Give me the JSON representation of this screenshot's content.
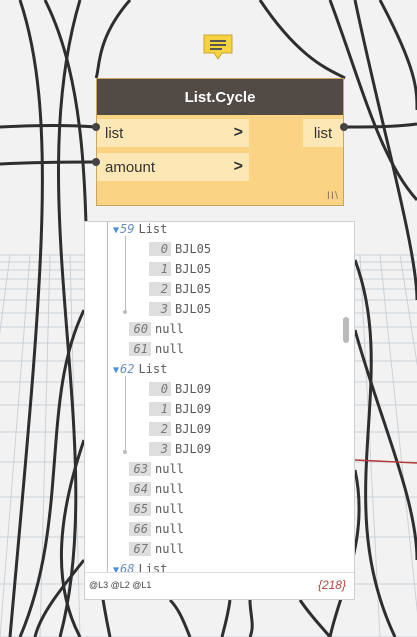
{
  "node": {
    "title": "List.Cycle",
    "inputs": [
      {
        "label": "list",
        "chevron": ">"
      },
      {
        "label": "amount",
        "chevron": ">"
      }
    ],
    "output": {
      "label": "list"
    },
    "lacing": "II\\"
  },
  "preview": {
    "rows": [
      {
        "type": "list",
        "index": "59",
        "label": "List"
      },
      {
        "type": "item",
        "index": "0",
        "value": "BJL05"
      },
      {
        "type": "item",
        "index": "1",
        "value": "BJL05"
      },
      {
        "type": "item",
        "index": "2",
        "value": "BJL05"
      },
      {
        "type": "item",
        "index": "3",
        "value": "BJL05"
      },
      {
        "type": "null",
        "index": "60",
        "value": "null"
      },
      {
        "type": "null",
        "index": "61",
        "value": "null"
      },
      {
        "type": "list",
        "index": "62",
        "label": "List"
      },
      {
        "type": "item",
        "index": "0",
        "value": "BJL09"
      },
      {
        "type": "item",
        "index": "1",
        "value": "BJL09"
      },
      {
        "type": "item",
        "index": "2",
        "value": "BJL09"
      },
      {
        "type": "item",
        "index": "3",
        "value": "BJL09"
      },
      {
        "type": "null",
        "index": "63",
        "value": "null"
      },
      {
        "type": "null",
        "index": "64",
        "value": "null"
      },
      {
        "type": "null",
        "index": "65",
        "value": "null"
      },
      {
        "type": "null",
        "index": "66",
        "value": "null"
      },
      {
        "type": "null",
        "index": "67",
        "value": "null"
      },
      {
        "type": "list",
        "index": "68",
        "label": "List"
      }
    ],
    "levels": "@L3 @L2 @L1",
    "count": "{218}"
  },
  "icons": {
    "preview_pin": "comment-bubble-icon",
    "expand": "triangle-down-icon"
  },
  "colors": {
    "node_body": "#fad384",
    "node_header": "#524a45",
    "count_text": "#b14545"
  }
}
